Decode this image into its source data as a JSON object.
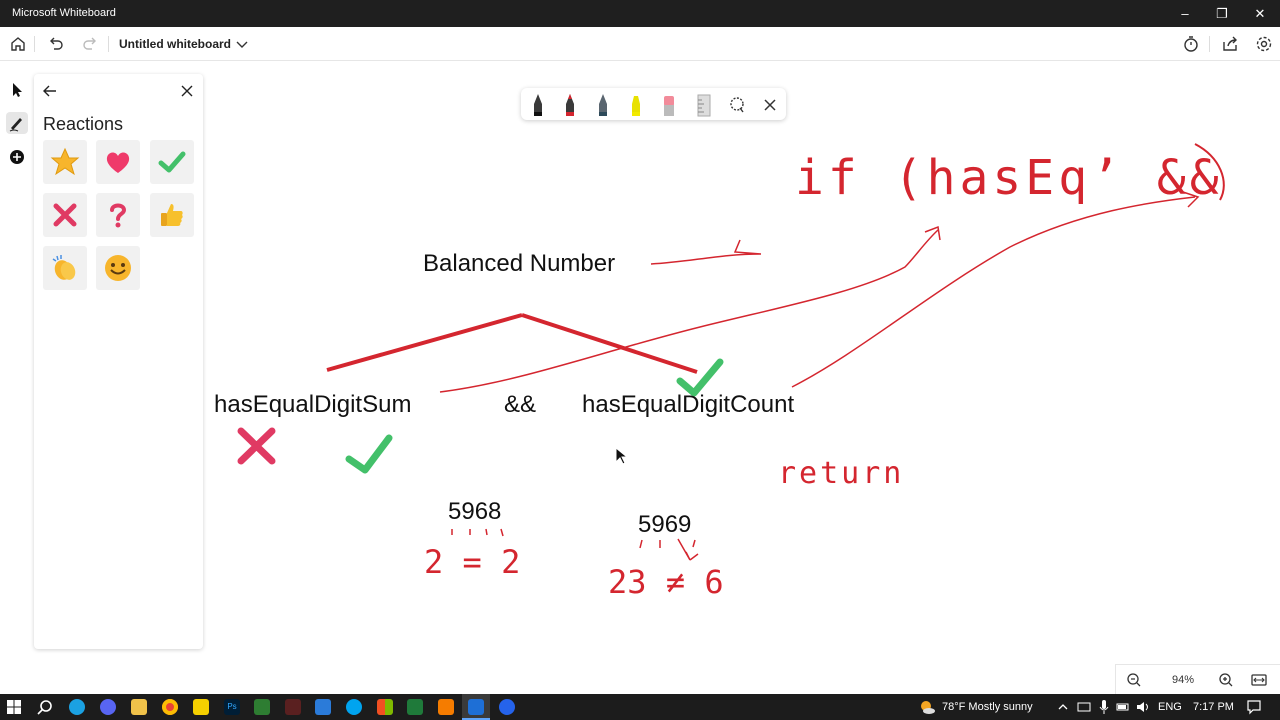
{
  "window": {
    "title": "Microsoft Whiteboard"
  },
  "toolbar": {
    "board_title": "Untitled whiteboard"
  },
  "panel": {
    "title": "Reactions",
    "items": [
      "star-icon",
      "heart-icon",
      "check-icon",
      "cross-icon",
      "question-icon",
      "thumbs-up-icon",
      "clapping-icon",
      "smiley-icon"
    ]
  },
  "pens": [
    "black-pen",
    "red-pen",
    "teal-pen",
    "yellow-highlighter",
    "eraser",
    "ruler",
    "lasso-select"
  ],
  "board": {
    "heading": "Balanced Number",
    "left_term": "hasEqualDigitSum",
    "operator": "&&",
    "right_term": "hasEqualDigitCount",
    "example_left": "5968",
    "example_right": "5969",
    "ink_if": "if (hasEq’ &&",
    "ink_return": "return",
    "ink_left_calc": "2 = 2",
    "ink_right_calc": "23 ≠ 6"
  },
  "zoom": {
    "value": "94%"
  },
  "taskbar": {
    "weather": "78°F  Mostly sunny",
    "language": "ENG",
    "time": "7:17 PM"
  },
  "colors": {
    "ink_red": "#d4262f",
    "check_green": "#43c06a",
    "cross_pink": "#e03a63"
  }
}
